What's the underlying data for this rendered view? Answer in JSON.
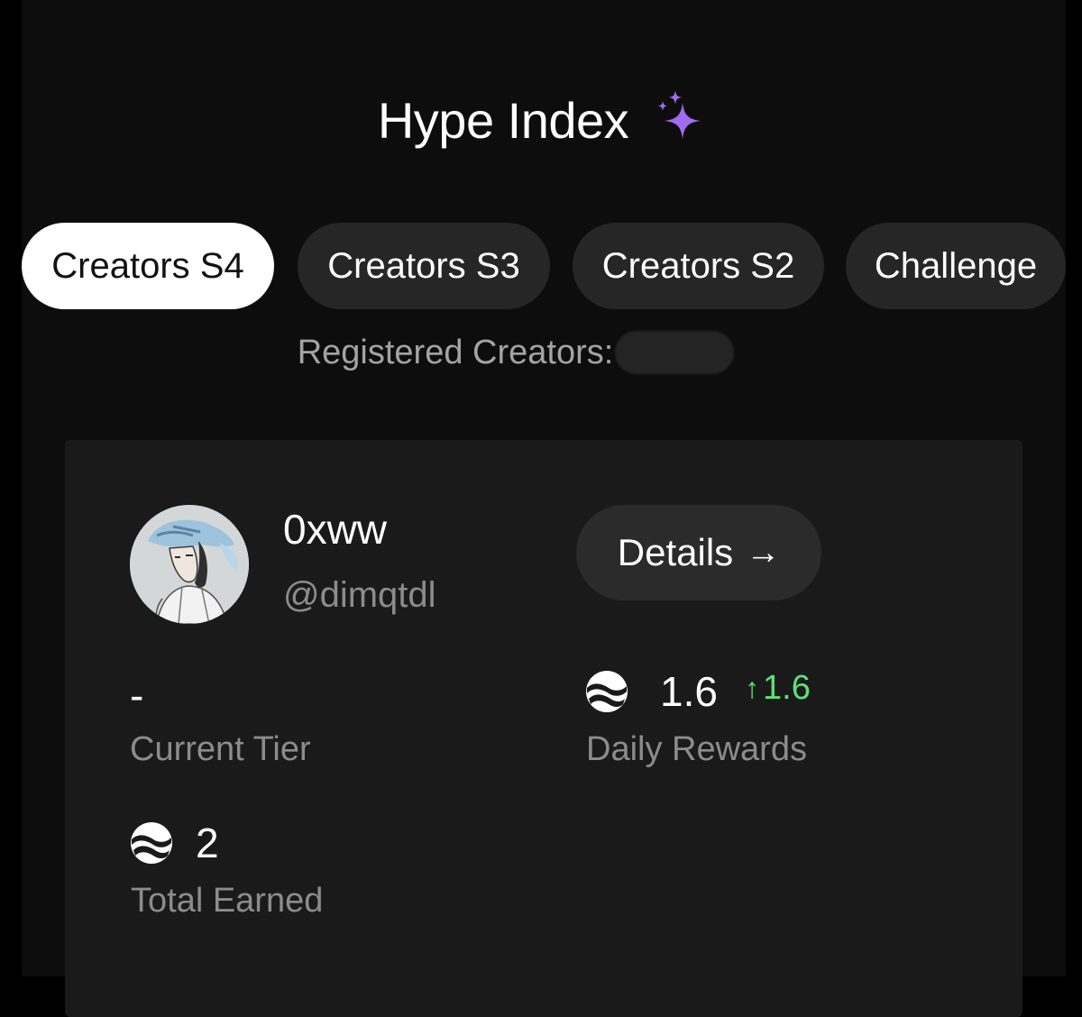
{
  "header": {
    "title": "Hype Index"
  },
  "tabs": [
    {
      "label": "Creators S4",
      "active": true
    },
    {
      "label": "Creators S3",
      "active": false
    },
    {
      "label": "Creators S2",
      "active": false
    },
    {
      "label": "Challenge",
      "active": false
    }
  ],
  "registered": {
    "label": "Registered Creators:"
  },
  "profile": {
    "name": "0xww",
    "handle": "@dimqtdl",
    "details_label": "Details"
  },
  "stats": {
    "tier_value": "-",
    "tier_label": "Current Tier",
    "daily_value": "1.6",
    "daily_change": "1.6",
    "daily_label": "Daily Rewards",
    "total_value": "2",
    "total_label": "Total Earned"
  },
  "colors": {
    "accent_sparkle": "#a06bf0",
    "positive_change": "#5ee07a",
    "active_tab_bg": "#ffffff",
    "tab_bg": "#262626",
    "card_bg": "#1a1a1a"
  },
  "icons": {
    "title_icon": "sparkles-icon",
    "reward_token": "token-coin-icon",
    "details_arrow": "arrow-right-icon",
    "change_arrow": "arrow-up-icon"
  }
}
